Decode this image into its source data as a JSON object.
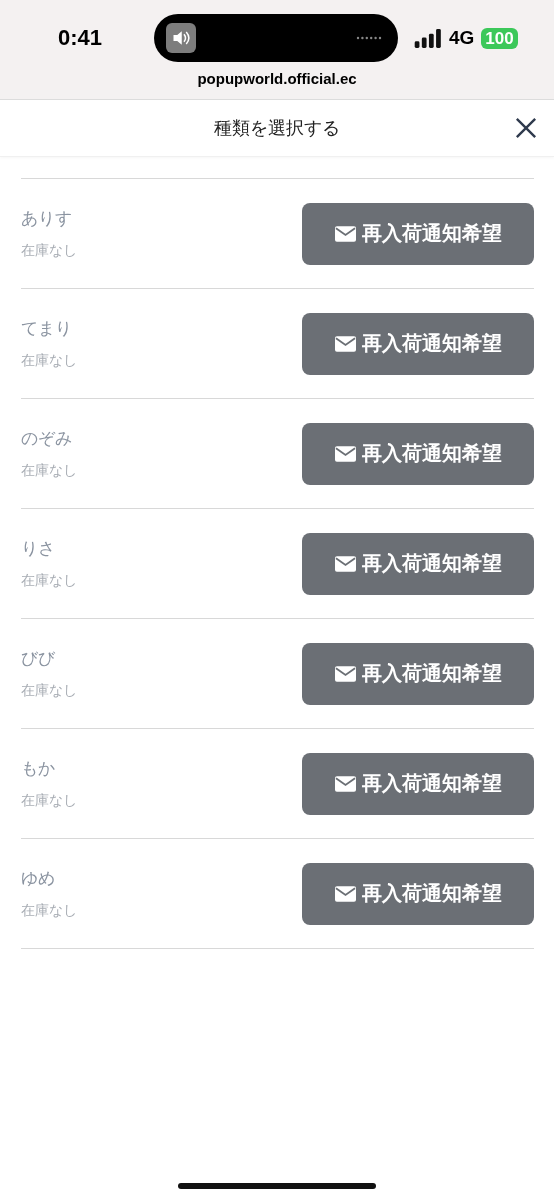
{
  "status_bar": {
    "time": "0:41",
    "network": "4G",
    "battery": "100"
  },
  "browser": {
    "address": "popupworld.official.ec"
  },
  "sheet": {
    "title": "種類を選択する"
  },
  "variants": [
    {
      "name": "ありす",
      "stock": "在庫なし",
      "button": "再入荷通知希望"
    },
    {
      "name": "てまり",
      "stock": "在庫なし",
      "button": "再入荷通知希望"
    },
    {
      "name": "のぞみ",
      "stock": "在庫なし",
      "button": "再入荷通知希望"
    },
    {
      "name": "りさ",
      "stock": "在庫なし",
      "button": "再入荷通知希望"
    },
    {
      "name": "びび",
      "stock": "在庫なし",
      "button": "再入荷通知希望"
    },
    {
      "name": "もか",
      "stock": "在庫なし",
      "button": "再入荷通知希望"
    },
    {
      "name": "ゆめ",
      "stock": "在庫なし",
      "button": "再入荷通知希望"
    }
  ]
}
